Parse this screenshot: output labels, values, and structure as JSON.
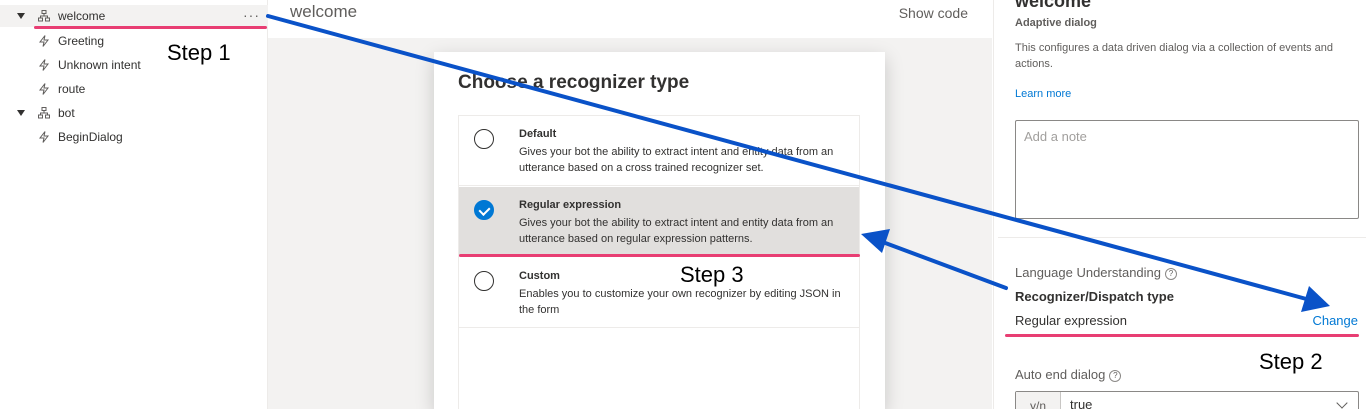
{
  "tree": {
    "items": [
      {
        "label": "welcome",
        "type": "dialog"
      },
      {
        "label": "Greeting",
        "type": "trigger"
      },
      {
        "label": "Unknown intent",
        "type": "trigger"
      },
      {
        "label": "route",
        "type": "trigger"
      },
      {
        "label": "bot",
        "type": "dialog"
      },
      {
        "label": "BeginDialog",
        "type": "trigger"
      }
    ],
    "more_label": "···"
  },
  "header": {
    "title": "welcome",
    "show_code": "Show code"
  },
  "modal": {
    "title": "Choose a recognizer type",
    "options": [
      {
        "title": "Default",
        "description": "Gives your bot the ability to extract intent and entity data from an utterance based on a cross trained recognizer set.",
        "selected": false
      },
      {
        "title": "Regular expression",
        "description": "Gives your bot the ability to extract intent and entity data from an utterance based on regular expression patterns.",
        "selected": true
      },
      {
        "title": "Custom",
        "description": "Enables you to customize your own recognizer by editing JSON in the form",
        "selected": false
      }
    ]
  },
  "properties": {
    "title": "welcome",
    "subtitle": "Adaptive dialog",
    "description": "This configures a data driven dialog via a collection of events and actions.",
    "learn_more": "Learn more",
    "note_placeholder": "Add a note",
    "language_understanding": "Language Understanding",
    "recognizer_label": "Recognizer/Dispatch type",
    "recognizer_value": "Regular expression",
    "change_link": "Change",
    "auto_end_label": "Auto end dialog",
    "auto_end_type": "y/n",
    "auto_end_value": "true",
    "help_glyph": "?"
  },
  "annotations": {
    "step1": "Step 1",
    "step2": "Step 2",
    "step3": "Step 3",
    "highlight_color": "#e83e73",
    "arrow_color": "#0a52c8"
  }
}
